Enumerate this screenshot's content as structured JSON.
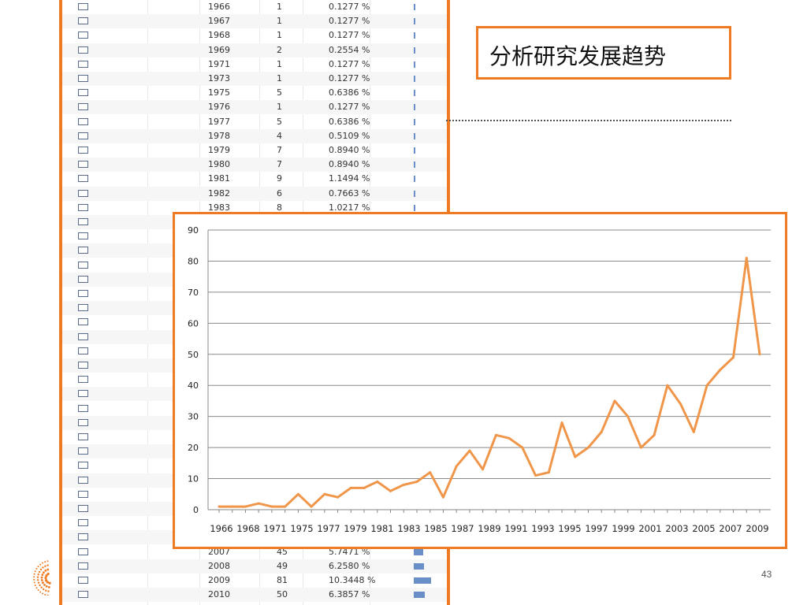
{
  "title": "分析研究发展趋势",
  "page_number": "43",
  "table": {
    "rows": [
      {
        "year": "1966",
        "count": "1",
        "pct": "0.1277 %",
        "bar": 1
      },
      {
        "year": "1967",
        "count": "1",
        "pct": "0.1277 %",
        "bar": 1
      },
      {
        "year": "1968",
        "count": "1",
        "pct": "0.1277 %",
        "bar": 1
      },
      {
        "year": "1969",
        "count": "2",
        "pct": "0.2554 %",
        "bar": 2
      },
      {
        "year": "1971",
        "count": "1",
        "pct": "0.1277 %",
        "bar": 1
      },
      {
        "year": "1973",
        "count": "1",
        "pct": "0.1277 %",
        "bar": 1
      },
      {
        "year": "1975",
        "count": "5",
        "pct": "0.6386 %",
        "bar": 5
      },
      {
        "year": "1976",
        "count": "1",
        "pct": "0.1277 %",
        "bar": 1
      },
      {
        "year": "1977",
        "count": "5",
        "pct": "0.6386 %",
        "bar": 5
      },
      {
        "year": "1978",
        "count": "4",
        "pct": "0.5109 %",
        "bar": 4
      },
      {
        "year": "1979",
        "count": "7",
        "pct": "0.8940 %",
        "bar": 7
      },
      {
        "year": "1980",
        "count": "7",
        "pct": "0.8940 %",
        "bar": 7
      },
      {
        "year": "1981",
        "count": "9",
        "pct": "1.1494 %",
        "bar": 9
      },
      {
        "year": "1982",
        "count": "6",
        "pct": "0.7663 %",
        "bar": 6
      },
      {
        "year": "1983",
        "count": "8",
        "pct": "1.0217 %",
        "bar": 8
      },
      {
        "year": "",
        "count": "",
        "pct": "",
        "bar": 0
      },
      {
        "year": "",
        "count": "",
        "pct": "",
        "bar": 0
      },
      {
        "year": "",
        "count": "",
        "pct": "",
        "bar": 0
      },
      {
        "year": "",
        "count": "",
        "pct": "",
        "bar": 0
      },
      {
        "year": "",
        "count": "",
        "pct": "",
        "bar": 0
      },
      {
        "year": "",
        "count": "",
        "pct": "",
        "bar": 0
      },
      {
        "year": "",
        "count": "",
        "pct": "",
        "bar": 0
      },
      {
        "year": "",
        "count": "",
        "pct": "",
        "bar": 0
      },
      {
        "year": "",
        "count": "",
        "pct": "",
        "bar": 0
      },
      {
        "year": "",
        "count": "",
        "pct": "",
        "bar": 0
      },
      {
        "year": "",
        "count": "",
        "pct": "",
        "bar": 0
      },
      {
        "year": "",
        "count": "",
        "pct": "",
        "bar": 0
      },
      {
        "year": "",
        "count": "",
        "pct": "",
        "bar": 0
      },
      {
        "year": "",
        "count": "",
        "pct": "",
        "bar": 0
      },
      {
        "year": "",
        "count": "",
        "pct": "",
        "bar": 0
      },
      {
        "year": "",
        "count": "",
        "pct": "",
        "bar": 0
      },
      {
        "year": "",
        "count": "",
        "pct": "",
        "bar": 0
      },
      {
        "year": "",
        "count": "",
        "pct": "",
        "bar": 0
      },
      {
        "year": "",
        "count": "",
        "pct": "",
        "bar": 0
      },
      {
        "year": "",
        "count": "",
        "pct": "",
        "bar": 0
      },
      {
        "year": "",
        "count": "",
        "pct": "",
        "bar": 0
      },
      {
        "year": "",
        "count": "",
        "pct": "",
        "bar": 0
      },
      {
        "year": "",
        "count": "",
        "pct": "",
        "bar": 0
      },
      {
        "year": "2007",
        "count": "45",
        "pct": "5.7471 %",
        "bar": 45
      },
      {
        "year": "2008",
        "count": "49",
        "pct": "6.2580 %",
        "bar": 49
      },
      {
        "year": "2009",
        "count": "81",
        "pct": "10.3448 %",
        "bar": 81
      },
      {
        "year": "2010",
        "count": "50",
        "pct": "6.3857 %",
        "bar": 50
      }
    ]
  },
  "colors": {
    "accent": "#ee7a22",
    "line": "#f0964a",
    "bar": "#6a8fc8",
    "grid": "#888888"
  },
  "chart_data": {
    "type": "line",
    "title": "",
    "xlabel": "",
    "ylabel": "",
    "ylim": [
      0,
      90
    ],
    "yticks": [
      0,
      10,
      20,
      30,
      40,
      50,
      60,
      70,
      80,
      90
    ],
    "x_tick_labels": [
      "1966",
      "1968",
      "1971",
      "1975",
      "1977",
      "1979",
      "1981",
      "1983",
      "1985",
      "1987",
      "1989",
      "1991",
      "1993",
      "1995",
      "1997",
      "1999",
      "2001",
      "2003",
      "2005",
      "2007",
      "2009"
    ],
    "x": [
      "1966",
      "1967",
      "1968",
      "1969",
      "1971",
      "1973",
      "1975",
      "1976",
      "1977",
      "1978",
      "1979",
      "1980",
      "1981",
      "1982",
      "1983",
      "1984",
      "1985",
      "1986",
      "1987",
      "1988",
      "1989",
      "1990",
      "1991",
      "1992",
      "1993",
      "1994",
      "1995",
      "1996",
      "1997",
      "1998",
      "1999",
      "2000",
      "2001",
      "2002",
      "2003",
      "2004",
      "2005",
      "2006",
      "2007",
      "2008",
      "2009",
      "2010"
    ],
    "values": [
      1,
      1,
      1,
      2,
      1,
      1,
      5,
      1,
      5,
      4,
      7,
      7,
      9,
      6,
      8,
      9,
      12,
      4,
      14,
      19,
      13,
      24,
      23,
      20,
      11,
      12,
      28,
      17,
      20,
      25,
      35,
      30,
      20,
      24,
      40,
      34,
      25,
      40,
      45,
      49,
      81,
      50
    ]
  }
}
